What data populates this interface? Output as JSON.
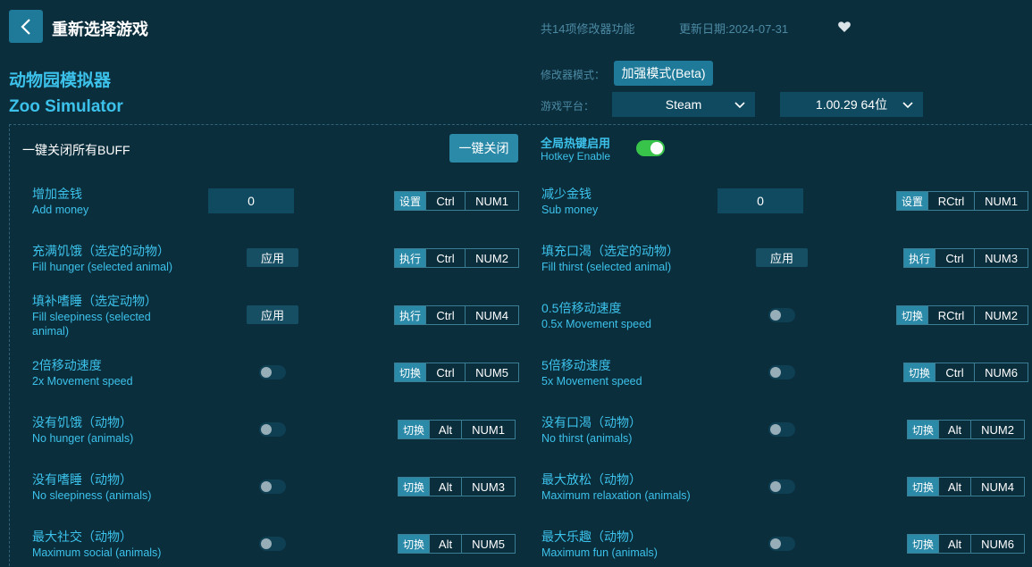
{
  "header": {
    "back_label": "重新选择游戏",
    "feature_count": "共14项修改器功能",
    "update_date": "更新日期:2024-07-31"
  },
  "game": {
    "title_cn": "动物园模拟器",
    "title_en": "Zoo Simulator"
  },
  "settings": {
    "mode_label": "修改器模式：",
    "mode_value": "加强模式(Beta)",
    "platform_label": "游戏平台：",
    "platform_value": "Steam",
    "version_value": "1.00.29 64位"
  },
  "panel": {
    "close_all_label": "一键关闭所有BUFF",
    "close_all_button": "一键关闭",
    "hotkey_cn": "全局热键启用",
    "hotkey_en": "Hotkey Enable",
    "hotkey_enabled": true
  },
  "features": [
    {
      "cn": "增加金钱",
      "en": "Add money",
      "control": "input",
      "value": "0",
      "action": "设置",
      "keys": [
        "Ctrl",
        "NUM1"
      ]
    },
    {
      "cn": "减少金钱",
      "en": "Sub money",
      "control": "input",
      "value": "0",
      "action": "设置",
      "keys": [
        "RCtrl",
        "NUM1"
      ]
    },
    {
      "cn": "充满饥饿（选定的动物）",
      "en": "Fill hunger (selected animal)",
      "control": "button",
      "button_label": "应用",
      "action": "执行",
      "keys": [
        "Ctrl",
        "NUM2"
      ]
    },
    {
      "cn": "填充口渴（选定的动物）",
      "en": "Fill thirst (selected animal)",
      "control": "button",
      "button_label": "应用",
      "action": "执行",
      "keys": [
        "Ctrl",
        "NUM3"
      ]
    },
    {
      "cn": "填补嗜睡（选定动物）",
      "en": "Fill sleepiness (selected animal)",
      "control": "button",
      "button_label": "应用",
      "action": "执行",
      "keys": [
        "Ctrl",
        "NUM4"
      ]
    },
    {
      "cn": "0.5倍移动速度",
      "en": "0.5x Movement speed",
      "control": "toggle",
      "on": false,
      "action": "切换",
      "keys": [
        "RCtrl",
        "NUM2"
      ]
    },
    {
      "cn": "2倍移动速度",
      "en": "2x Movement speed",
      "control": "toggle",
      "on": false,
      "action": "切换",
      "keys": [
        "Ctrl",
        "NUM5"
      ]
    },
    {
      "cn": "5倍移动速度",
      "en": "5x Movement speed",
      "control": "toggle",
      "on": false,
      "action": "切换",
      "keys": [
        "Ctrl",
        "NUM6"
      ]
    },
    {
      "cn": "没有饥饿（动物）",
      "en": "No hunger (animals)",
      "control": "toggle",
      "on": false,
      "action": "切换",
      "keys": [
        "Alt",
        "NUM1"
      ]
    },
    {
      "cn": "没有口渴（动物）",
      "en": "No thirst (animals)",
      "control": "toggle",
      "on": false,
      "action": "切换",
      "keys": [
        "Alt",
        "NUM2"
      ]
    },
    {
      "cn": "没有嗜睡（动物）",
      "en": "No sleepiness (animals)",
      "control": "toggle",
      "on": false,
      "action": "切换",
      "keys": [
        "Alt",
        "NUM3"
      ]
    },
    {
      "cn": "最大放松（动物）",
      "en": "Maximum relaxation (animals)",
      "control": "toggle",
      "on": false,
      "action": "切换",
      "keys": [
        "Alt",
        "NUM4"
      ]
    },
    {
      "cn": "最大社交（动物）",
      "en": "Maximum social (animals)",
      "control": "toggle",
      "on": false,
      "action": "切换",
      "keys": [
        "Alt",
        "NUM5"
      ]
    },
    {
      "cn": "最大乐趣（动物）",
      "en": "Maximum fun (animals)",
      "control": "toggle",
      "on": false,
      "action": "切换",
      "keys": [
        "Alt",
        "NUM6"
      ]
    }
  ],
  "colors": {
    "background": "#0b2e3d",
    "accent": "#3cc2ea",
    "button": "#1e7a98",
    "toggle_on": "#38c34b"
  },
  "icons": [
    "back-arrow-icon",
    "heart-icon",
    "chevron-down-icon"
  ]
}
